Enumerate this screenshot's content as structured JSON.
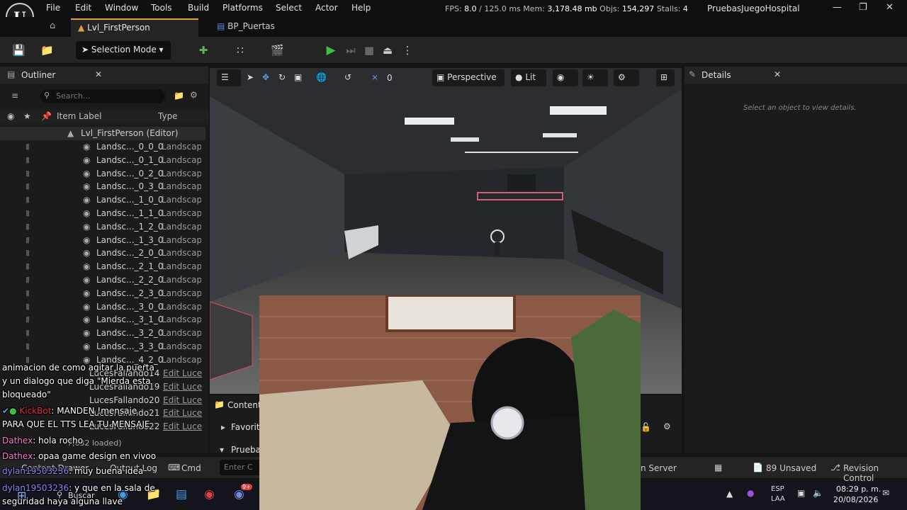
{
  "menu": [
    "File",
    "Edit",
    "Window",
    "Tools",
    "Build",
    "Platforms",
    "Select",
    "Actor",
    "Help"
  ],
  "stats": {
    "fps_label": "FPS:",
    "fps": "8.0",
    "ms": "/ 125.0 ms",
    "mem_label": "Mem:",
    "mem": "3,178.48 mb",
    "objs_label": "Objs:",
    "objs": "154,297",
    "stalls_label": "Stalls:",
    "stalls": "4"
  },
  "project_name": "PruebasJuegoHospital",
  "tabs": {
    "level": "Lvl_FirstPerson",
    "bp": "BP_Puertas"
  },
  "toolbar": {
    "selection_mode": "Selection Mode"
  },
  "outliner": {
    "title": "Outliner",
    "search_placeholder": "Search...",
    "col_label": "Item Label",
    "col_type": "Type",
    "root": "Lvl_FirstPerson (Editor)",
    "rows": [
      {
        "label": "Landsc..._0_0_0",
        "type": "Landscap"
      },
      {
        "label": "Landsc..._0_1_0",
        "type": "Landscap"
      },
      {
        "label": "Landsc..._0_2_0",
        "type": "Landscap"
      },
      {
        "label": "Landsc..._0_3_0",
        "type": "Landscap"
      },
      {
        "label": "Landsc..._1_0_0",
        "type": "Landscap"
      },
      {
        "label": "Landsc..._1_1_0",
        "type": "Landscap"
      },
      {
        "label": "Landsc..._1_2_0",
        "type": "Landscap"
      },
      {
        "label": "Landsc..._1_3_0",
        "type": "Landscap"
      },
      {
        "label": "Landsc..._2_0_0",
        "type": "Landscap"
      },
      {
        "label": "Landsc..._2_1_0",
        "type": "Landscap"
      },
      {
        "label": "Landsc..._2_2_0",
        "type": "Landscap"
      },
      {
        "label": "Landsc..._2_3_0",
        "type": "Landscap"
      },
      {
        "label": "Landsc..._3_0_0",
        "type": "Landscap"
      },
      {
        "label": "Landsc..._3_1_0",
        "type": "Landscap"
      },
      {
        "label": "Landsc..._3_2_0",
        "type": "Landscap"
      },
      {
        "label": "Landsc..._3_3_0",
        "type": "Landscap"
      },
      {
        "label": "Landsc..._4_2_0",
        "type": "Landscap"
      }
    ],
    "light_rows": [
      {
        "label": "LucesFallando14",
        "type": "Edit Luce"
      },
      {
        "label": "LucesFallando19",
        "type": "Edit Luce"
      },
      {
        "label": "LucesFallando20",
        "type": "Edit Luce"
      },
      {
        "label": "LucesFallando21",
        "type": "Edit Luce"
      },
      {
        "label": "LucesFallando22",
        "type": "Edit Luce"
      }
    ],
    "footer": "7,632 loaded)"
  },
  "viewport": {
    "perspective": "Perspective",
    "lit": "Lit",
    "snap": "0"
  },
  "details": {
    "title": "Details",
    "empty": "Select an object to view details."
  },
  "content": {
    "drawer": "Content",
    "favorites": "Favorit",
    "pruebas": "Pruebas"
  },
  "statusbar": {
    "content_drawer": "Content Drawer",
    "output_log": "Output Log",
    "cmd": "Cmd",
    "console_placeholder": "Enter C",
    "server": "n Server",
    "unsaved": "89 Unsaved",
    "revision": "Revision Control"
  },
  "taskbar": {
    "search": "Buscar",
    "lang1": "ESP",
    "lang2": "LAA",
    "time": "08:29 p. m.",
    "date": "20/08/2026",
    "badge": "9+"
  },
  "chat": [
    {
      "user": "",
      "text": "animacion de como agitar la puerta"
    },
    {
      "user": "",
      "text": "y un dialogo que diga \"Mierda esta"
    },
    {
      "user": "",
      "text": "bloqueado\""
    },
    {
      "user": "KickBot",
      "text": ": MANDEN !mensaje"
    },
    {
      "user": "",
      "text": "PARA QUE EL TTS LEA TU MENSAJE"
    },
    {
      "user": "Dathex",
      "text": ": hola rocho"
    },
    {
      "user": "Dathex",
      "text": ": opaa game design en vivoo"
    },
    {
      "user": "dylan19503236",
      "text": ": muy buena idea"
    },
    {
      "user": "dylan19503236",
      "text": ": y que en la sala de"
    },
    {
      "user": "",
      "text": "seguridad haya alguna llave"
    }
  ],
  "colors": {
    "accent": "#e0a040",
    "play": "#3fbf3f",
    "link": "#5aa0e6",
    "kickbot": "#e0304a",
    "dathex": "#ff7ad9",
    "dylan": "#8a8aff"
  }
}
